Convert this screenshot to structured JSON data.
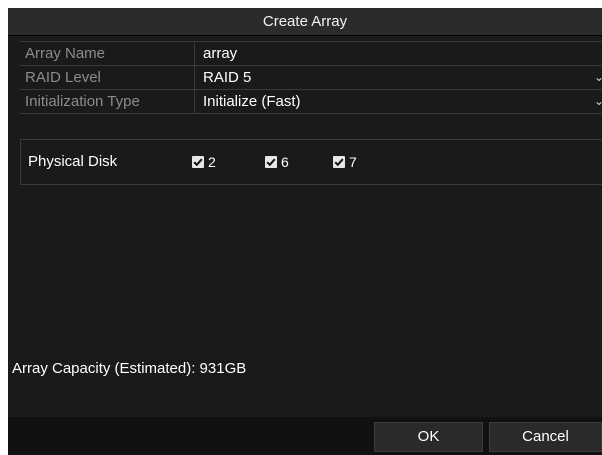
{
  "dialog": {
    "title": "Create Array"
  },
  "form": {
    "array_name": {
      "label": "Array Name",
      "value": "array"
    },
    "raid_level": {
      "label": "RAID Level",
      "value": "RAID 5"
    },
    "init_type": {
      "label": "Initialization Type",
      "value": "Initialize (Fast)"
    }
  },
  "physical_disk": {
    "label": "Physical Disk",
    "disks": [
      {
        "number": "2",
        "checked": true
      },
      {
        "number": "6",
        "checked": true
      },
      {
        "number": "7",
        "checked": true
      }
    ]
  },
  "capacity_text": "Array Capacity (Estimated): 931GB",
  "buttons": {
    "ok": "OK",
    "cancel": "Cancel"
  },
  "icons": {
    "dropdown": "chevron-down-icon",
    "checkbox": "checkbox-checked-icon"
  },
  "colors": {
    "background": "#1a1a1a",
    "titlebar": "#2b2b2b",
    "label_text": "#8c8c8c",
    "value_text": "#ffffff",
    "grid_line": "#3a3a3a"
  }
}
